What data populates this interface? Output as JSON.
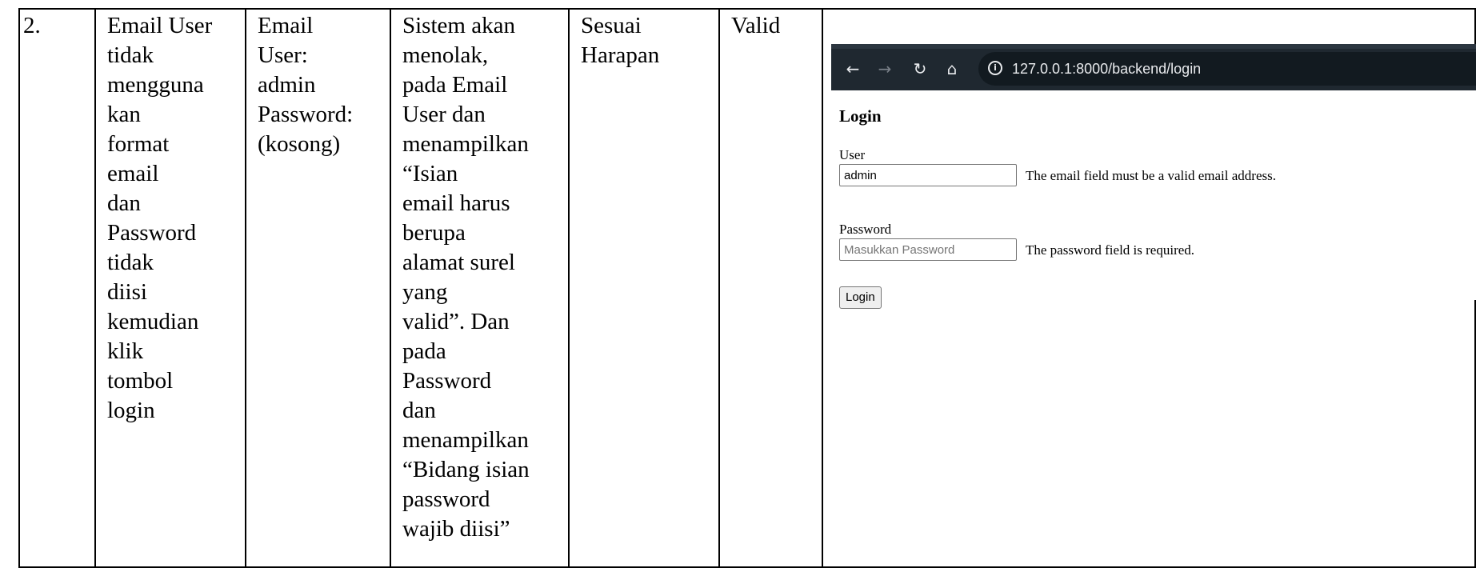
{
  "table": {
    "row": {
      "no": "2.",
      "test_case": "Email User\ntidak\nmengguna\nkan\nformat\nemail\ndan\nPassword\ntidak\ndiisi\nkemudian\nklik\ntombol\nlogin",
      "test_data": "Email\nUser:\nadmin\nPassword:\n(kosong)",
      "expected": "Sistem akan\nmenolak,\npada Email\nUser dan\nmenampilkan\n“Isian\nemail harus\nberupa\nalamat surel\nyang\nvalid”. Dan\npada\nPassword\ndan\nmenampilkan\n“Bidang isian\npassword\nwajib diisi”",
      "observed": "Sesuai\nHarapan",
      "result": "Valid"
    }
  },
  "browser": {
    "url": "127.0.0.1:8000/backend/login",
    "icons": {
      "back": "arrow-left-icon",
      "forward": "arrow-right-icon",
      "reload": "reload-icon",
      "home": "home-icon",
      "info": "info-icon"
    }
  },
  "login_page": {
    "heading": "Login",
    "user_label": "User",
    "user_value": "admin",
    "user_error": "The email field must be a valid email address.",
    "password_label": "Password",
    "password_placeholder": "Masukkan Password",
    "password_error": "The password field is required.",
    "button_label": "Login"
  },
  "colors": {
    "browser_bar": "#1f2830",
    "url_pill": "#121a20",
    "url_text": "#e8eaed"
  }
}
